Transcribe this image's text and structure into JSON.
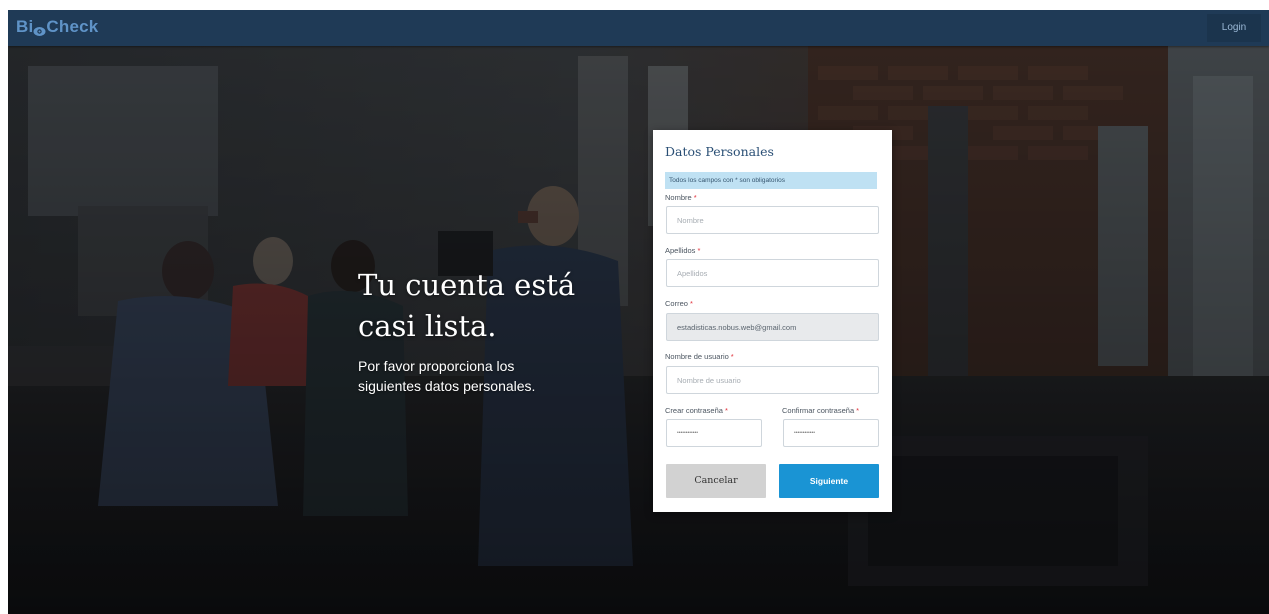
{
  "navbar": {
    "brand_prefix": "Bi",
    "brand_suffix": "Check",
    "login_label": "Login"
  },
  "hero": {
    "title_line1": "Tu cuenta está",
    "title_line2": "casi lista.",
    "subtitle_line1": "Por favor proporciona los",
    "subtitle_line2": "siguientes datos personales."
  },
  "form": {
    "title": "Datos Personales",
    "notice": "Todos los campos con * son obligatorios",
    "required_mark": "*",
    "fields": {
      "nombre": {
        "label": "Nombre",
        "placeholder": "Nombre",
        "value": ""
      },
      "apellidos": {
        "label": "Apellidos",
        "placeholder": "Apellidos",
        "value": ""
      },
      "correo": {
        "label": "Correo",
        "placeholder": "",
        "value": "estadisticas.nobus.web@gmail.com"
      },
      "usuario": {
        "label": "Nombre de usuario",
        "placeholder": "Nombre de usuario",
        "value": ""
      },
      "crear_contrasena": {
        "label": "Crear contraseña",
        "value": "••••••••••••"
      },
      "confirmar_contrasena": {
        "label": "Confirmar contraseña",
        "value": "••••••••••••"
      }
    },
    "cancel_label": "Cancelar",
    "next_label": "Siguiente"
  },
  "colors": {
    "navbar": "#1f3a56",
    "brand": "#5f93c7",
    "primary_button": "#1a94d4",
    "cancel_button": "#d2d2d2",
    "notice_bg": "#bfe1f3",
    "required": "#e1303a"
  },
  "icons": {
    "brand_logo": "eye-logo-icon"
  }
}
